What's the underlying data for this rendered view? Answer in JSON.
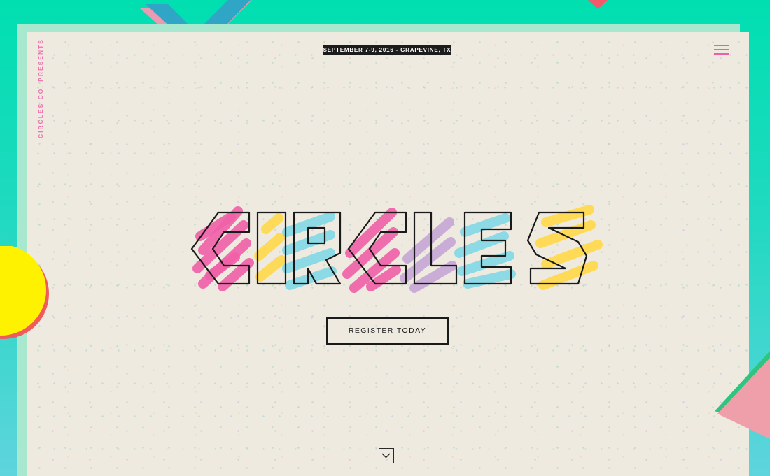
{
  "header": {
    "presents_label": "CIRCLES CO. PRESENTS",
    "event_date_location": "SEPTEMBER 7-9, 2016 - GRAPEVINE, TX"
  },
  "hero": {
    "logo_text": "CIRCLES",
    "cta_label": "REGISTER TODAY"
  },
  "icons": {
    "menu": "hamburger-menu-icon",
    "scroll": "chevron-down-icon"
  },
  "colors": {
    "background_teal": "#00dfb0",
    "card_background": "#efeae0",
    "pink": "#ef5fa7",
    "cyan": "#7fd8e6",
    "yellow": "#ffd84a",
    "lavender": "#c4a6d6",
    "ink": "#1a1a1a"
  }
}
